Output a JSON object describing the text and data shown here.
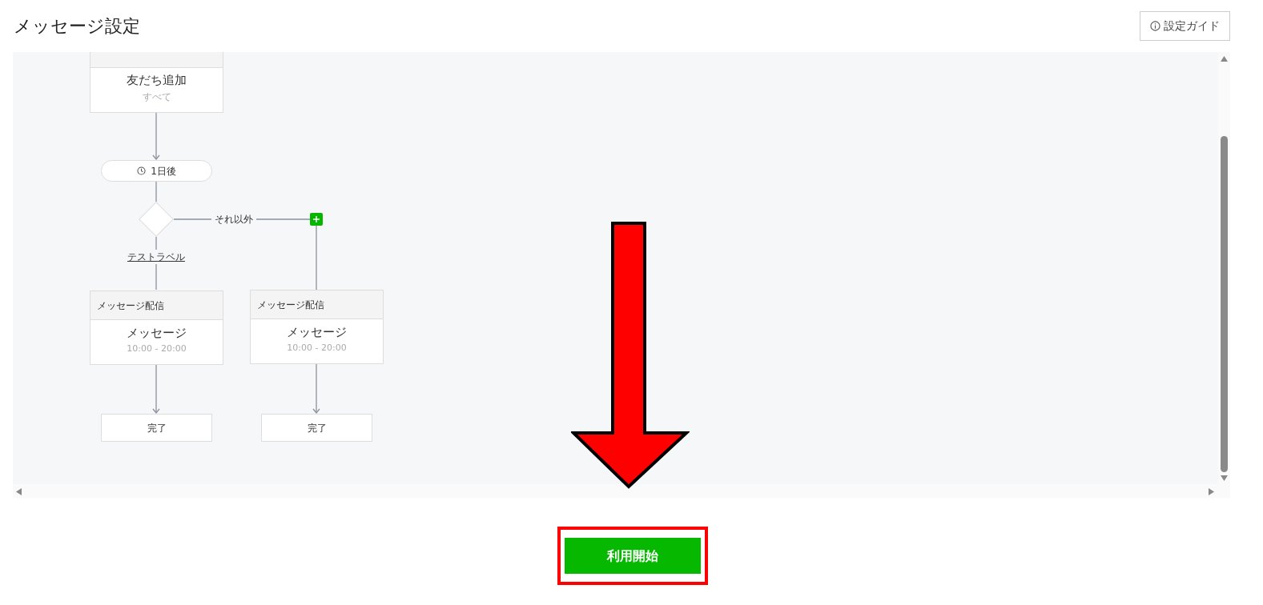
{
  "header": {
    "title": "メッセージ設定",
    "guide_button": "設定ガイド"
  },
  "flow": {
    "start": {
      "title": "友だち追加",
      "subtitle": "すべて"
    },
    "wait": {
      "label": "1日後"
    },
    "branch": {
      "else_label": "それ以外",
      "match_label": "テストラベル"
    },
    "steps": [
      {
        "header": "メッセージ配信",
        "title": "メッセージ",
        "subtitle": "10:00 - 20:00",
        "end": "完了"
      },
      {
        "header": "メッセージ配信",
        "title": "メッセージ",
        "subtitle": "10:00 - 20:00",
        "end": "完了"
      }
    ]
  },
  "start_button": "利用開始"
}
